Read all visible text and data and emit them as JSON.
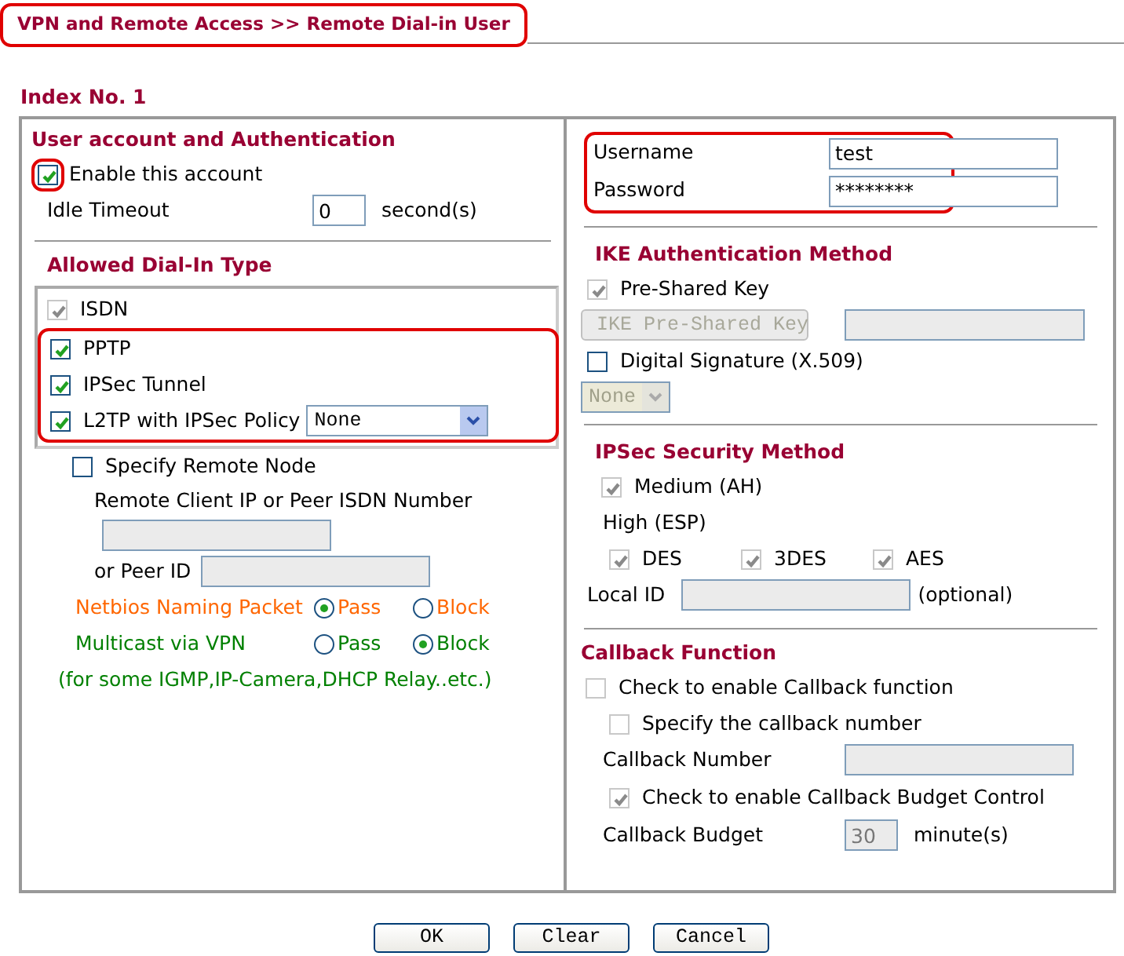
{
  "title": {
    "text": "VPN and Remote Access >> Remote Dial-in User",
    "highlighted": true
  },
  "index_label": "Index No. 1",
  "account": {
    "heading": "User account and Authentication",
    "enable": {
      "label": "Enable this account",
      "checked": true,
      "disabled": false,
      "highlighted": true
    },
    "idle_timeout": {
      "label": "Idle Timeout",
      "value": "0",
      "unit": "second(s)",
      "disabled": false
    }
  },
  "dial_in": {
    "heading": "Allowed Dial-In Type",
    "types": [
      {
        "label": "ISDN",
        "checked": true,
        "disabled": true,
        "highlighted": false
      },
      {
        "label": "PPTP",
        "checked": true,
        "disabled": false,
        "highlighted": true
      },
      {
        "label": "IPSec Tunnel",
        "checked": true,
        "disabled": false,
        "highlighted": true
      },
      {
        "label": "L2TP with IPSec Policy",
        "checked": true,
        "disabled": false,
        "highlighted": true,
        "policy": "None"
      }
    ]
  },
  "remote_node": {
    "specify": {
      "label": "Specify Remote Node",
      "checked": false,
      "disabled": false
    },
    "client_ip": {
      "label": "Remote Client IP or Peer ISDN Number",
      "disabled": true
    },
    "peer_id": {
      "label": "or Peer ID",
      "disabled": true
    }
  },
  "options": [
    {
      "label": "Netbios Naming Packet",
      "color": "#ff6600",
      "choices": [
        {
          "label": "Pass",
          "selected": true
        },
        {
          "label": "Block",
          "selected": false
        }
      ]
    },
    {
      "label": "Multicast via VPN",
      "color": "#008000",
      "choices": [
        {
          "label": "Pass",
          "selected": false
        },
        {
          "label": "Block",
          "selected": true
        }
      ]
    }
  ],
  "note": "(for some IGMP,IP-Camera,DHCP Relay..etc.)",
  "credentials": {
    "highlighted": true,
    "fields": [
      {
        "label": "Username",
        "value": "test",
        "disabled": false
      },
      {
        "label": "Password",
        "value": "********",
        "disabled": false
      }
    ]
  },
  "ike": {
    "heading": "IKE Authentication Method",
    "pre_shared": {
      "label": "Pre-Shared Key",
      "checked": true,
      "disabled": true
    },
    "key_button": {
      "label": "IKE Pre-Shared Key",
      "disabled": true
    },
    "key_field": {
      "disabled": true
    },
    "digital_signature": {
      "label": "Digital Signature (X.509)",
      "checked": false,
      "disabled": false
    },
    "signature_select": {
      "value": "None",
      "disabled": true
    }
  },
  "ipsec": {
    "heading": "IPSec Security Method",
    "medium": {
      "label": "Medium (AH)",
      "checked": true,
      "disabled": true
    },
    "high_label": "High (ESP)",
    "ciphers": [
      {
        "label": "DES",
        "checked": true,
        "disabled": true
      },
      {
        "label": "3DES",
        "checked": true,
        "disabled": true
      },
      {
        "label": "AES",
        "checked": true,
        "disabled": true
      }
    ],
    "local_id": {
      "label": "Local ID",
      "hint": "(optional)",
      "disabled": true
    }
  },
  "callback": {
    "heading": "Callback Function",
    "enable": {
      "label": "Check to enable Callback function",
      "checked": false,
      "disabled": true
    },
    "specify": {
      "label": "Specify the callback number",
      "checked": false,
      "disabled": true
    },
    "number": {
      "label": "Callback Number",
      "disabled": true
    },
    "budget_control": {
      "label": "Check to enable Callback Budget Control",
      "checked": true,
      "disabled": true
    },
    "budget": {
      "label": "Callback Budget",
      "value": "30",
      "unit": "minute(s)",
      "disabled": true
    }
  },
  "buttons": [
    "OK",
    "Clear",
    "Cancel"
  ]
}
